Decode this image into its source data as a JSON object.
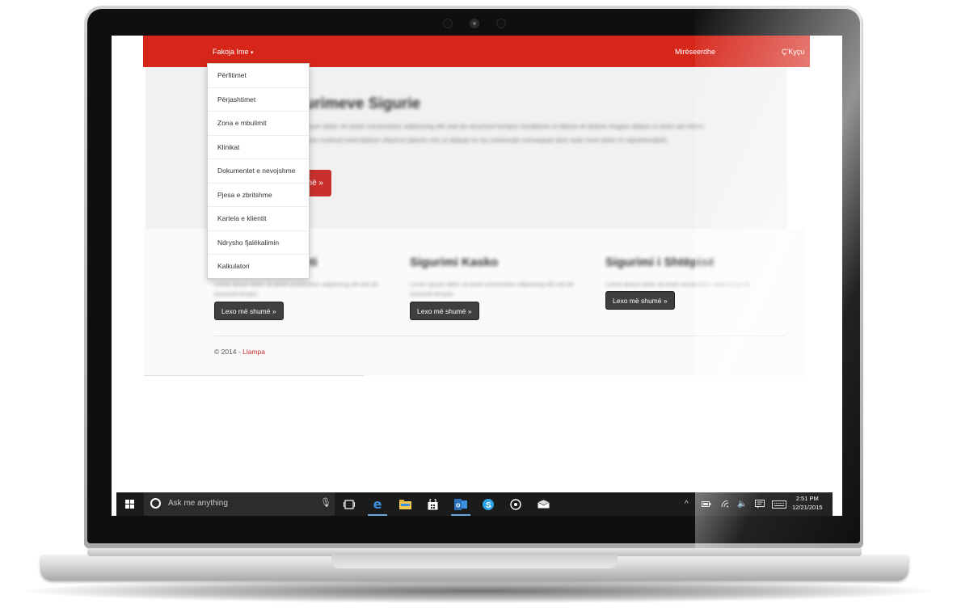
{
  "site": {
    "nav": {
      "dropdown_label": "Fakoja Ime",
      "welcome": "Mirëseerdhe",
      "logout": "Ç'Kyçu"
    },
    "menu": [
      "Përfitimet",
      "Përjashtimet",
      "Zona e mbulimit",
      "Klinikat",
      "Dokumentet e nevojshme",
      "Pjesa e zbritshme",
      "Kartela e klientit",
      "Ndrysho fjalëkalimin",
      "Kalkulatori"
    ],
    "jumbotron": {
      "title": "Sigurimeve Sigurie",
      "text": "Lorem ipsum dolor sit amet consectetur adipiscing elit sed do eiusmod tempor incididunt ut labore et dolore magna aliqua ut enim ad minim veniam quis nostrud exercitation ullamco laboris nisi ut aliquip ex ea commodo consequat duis aute irure dolor in reprehenderit.",
      "button": "më »"
    },
    "columns": [
      {
        "title": "Sigurimi Shendeti",
        "text": "Lorem ipsum dolor sit amet consectetur adipiscing elit sed do eiusmod tempor.",
        "button": "Lexo më shumë »"
      },
      {
        "title": "Sigurimi Kasko",
        "text": "Lorem ipsum dolor sit amet consectetur adipiscing elit sed do eiusmod tempor.",
        "button": "Lexo më shumë »"
      },
      {
        "title": "Sigurimi i Shtëpisë",
        "text": "Lorem ipsum dolor sit amet consectetur adipiscing elit.",
        "button": "Lexo më shumë »"
      }
    ],
    "footer": {
      "copyright": "© 2014 - ",
      "brand": "Llampa"
    }
  },
  "taskbar": {
    "search_placeholder": "Ask me anything",
    "time": "2:51 PM",
    "date": "12/21/2015",
    "icons": [
      "task-view-icon",
      "edge-icon",
      "file-explorer-icon",
      "store-icon",
      "outlook-icon",
      "skype-icon",
      "groove-music-icon",
      "mail-icon"
    ]
  },
  "colors": {
    "brand_red": "#d6261a",
    "taskbar": "#1b1b1b"
  }
}
